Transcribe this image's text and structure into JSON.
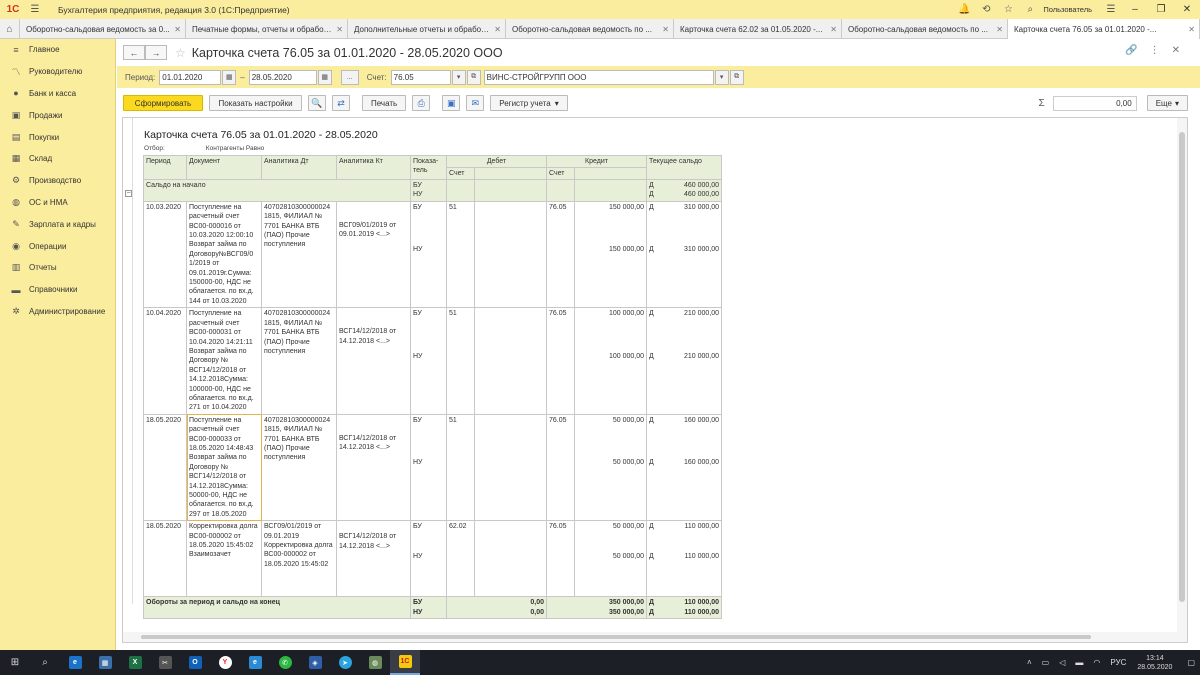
{
  "app": {
    "title": "Бухгалтерия предприятия, редакция 3.0  (1С:Предприятие)",
    "user": "Пользователь"
  },
  "tabs": [
    "Оборотно-сальдовая ведомость за 0...",
    "Печатные формы, отчеты и обработки",
    "Дополнительные отчеты и обработки",
    "Оборотно-сальдовая ведомость по ...",
    "Карточка счета 62.02 за 01.05.2020 -...",
    "Оборотно-сальдовая ведомость по ...",
    "Карточка счета 76.05 за 01.01.2020 -..."
  ],
  "sidebar": [
    {
      "label": "Главное",
      "icon": "menu-icon"
    },
    {
      "label": "Руководителю",
      "icon": "chart-line-icon"
    },
    {
      "label": "Банк и касса",
      "icon": "bank-icon"
    },
    {
      "label": "Продажи",
      "icon": "sales-icon"
    },
    {
      "label": "Покупки",
      "icon": "cart-icon"
    },
    {
      "label": "Склад",
      "icon": "warehouse-icon"
    },
    {
      "label": "Производство",
      "icon": "factory-icon"
    },
    {
      "label": "ОС и НМА",
      "icon": "assets-icon"
    },
    {
      "label": "Зарплата и кадры",
      "icon": "people-icon"
    },
    {
      "label": "Операции",
      "icon": "operations-icon"
    },
    {
      "label": "Отчеты",
      "icon": "reports-icon"
    },
    {
      "label": "Справочники",
      "icon": "book-icon"
    },
    {
      "label": "Администрирование",
      "icon": "gear-icon"
    }
  ],
  "document": {
    "title": "Карточка счета 76.05 за 01.01.2020 - 28.05.2020 ООО"
  },
  "filters": {
    "period_label": "Период:",
    "date_from": "01.01.2020",
    "dash": "–",
    "date_to": "28.05.2020",
    "dots": "...",
    "account_label": "Счет:",
    "account": "76.05",
    "counterparty": "ВИНС-СТРОЙГРУПП ООО"
  },
  "toolbar": {
    "generate": "Сформировать",
    "show_settings": "Показать настройки",
    "print": "Печать",
    "registry": "Регистр учета",
    "sum_symbol": "Σ",
    "sum_value": "0,00",
    "more": "Еще"
  },
  "report": {
    "title": "Карточка счета 76.05 за 01.01.2020 - 28.05.2020",
    "filter_label": "Отбор:",
    "filter_value": "Контрагенты Равно",
    "headers": {
      "period": "Период",
      "document": "Документ",
      "analytics_dt": "Аналитика Дт",
      "analytics_kt": "Аналитика Кт",
      "indicator": "Показа-\nтель",
      "debit": "Дебет",
      "credit": "Кредит",
      "balance": "Текущее сальдо",
      "account": "Счет"
    },
    "opening": {
      "label": "Сальдо на начало",
      "bu": "БУ",
      "nu": "НУ",
      "d1": "Д",
      "v1": "460 000,00",
      "d2": "Д",
      "v2": "460 000,00"
    },
    "rows": [
      {
        "period": "10.03.2020",
        "document": "Поступление на расчетный счет ВС00-000016 от 10.03.2020 12:00:10 Возврат займа по Договору№ВСГ09/0 1/2019 от 09.01.2019г.Сумма: 150000-00, НДС не облагается. по вх.д. 144 от 10.03.2020",
        "analytics_dt": "40702810300000024 1815, ФИЛИАЛ № 7701 БАНКА ВТБ (ПАО) Прочие поступления",
        "analytics_kt": "ВСГ09/01/2019 от 09.01.2019 <...>",
        "bu": "БУ",
        "nu": "НУ",
        "debit_acc": "51",
        "credit_acc": "76.05",
        "credit_bu": "150 000,00",
        "credit_nu": "150 000,00",
        "bal_d1": "Д",
        "bal_bu": "310 000,00",
        "bal_d2": "Д",
        "bal_nu": "310 000,00"
      },
      {
        "period": "10.04.2020",
        "document": "Поступление на расчетный счет ВС00-000031 от 10.04.2020 14:21:11 Возврат займа по Договору № ВСГ14/12/2018 от 14.12.2018Сумма: 100000-00, НДС не облагается. по вх.д. 271 от 10.04.2020",
        "analytics_dt": "40702810300000024 1815, ФИЛИАЛ № 7701 БАНКА ВТБ (ПАО) Прочие поступления",
        "analytics_kt": "ВСГ14/12/2018 от 14.12.2018 <...>",
        "bu": "БУ",
        "nu": "НУ",
        "debit_acc": "51",
        "credit_acc": "76.05",
        "credit_bu": "100 000,00",
        "credit_nu": "100 000,00",
        "bal_d1": "Д",
        "bal_bu": "210 000,00",
        "bal_d2": "Д",
        "bal_nu": "210 000,00"
      },
      {
        "period": "18.05.2020",
        "document": "Поступление на расчетный счет ВС00-000033 от 18.05.2020 14:48:43 Возврат займа по Договору № ВСГ14/12/2018 от 14.12.2018Сумма: 50000-00, НДС не облагается. по вх.д. 297 от 18.05.2020",
        "analytics_dt": "40702810300000024 1815, ФИЛИАЛ № 7701 БАНКА ВТБ (ПАО) Прочие поступления",
        "analytics_kt": "ВСГ14/12/2018 от 14.12.2018 <...>",
        "bu": "БУ",
        "nu": "НУ",
        "debit_acc": "51",
        "credit_acc": "76.05",
        "credit_bu": "50 000,00",
        "credit_nu": "50 000,00",
        "bal_d1": "Д",
        "bal_bu": "160 000,00",
        "bal_d2": "Д",
        "bal_nu": "160 000,00"
      },
      {
        "period": "18.05.2020",
        "document": "Корректировка долга ВС00-000002 от 18.05.2020 15:45:02 Взаимозачет",
        "analytics_dt": "ВСГ09/01/2019 от 09.01.2019 Корректировка долга ВС00-000002 от 18.05.2020 15:45:02",
        "analytics_kt": "ВСГ14/12/2018 от 14.12.2018 <...>",
        "bu": "БУ",
        "nu": "НУ",
        "debit_acc": "62.02",
        "credit_acc": "76.05",
        "credit_bu": "50 000,00",
        "credit_nu": "50 000,00",
        "bal_d1": "Д",
        "bal_bu": "110 000,00",
        "bal_d2": "Д",
        "bal_nu": "110 000,00"
      }
    ],
    "totals": {
      "label": "Обороты за период и сальдо на конец",
      "bu": "БУ",
      "nu": "НУ",
      "debit_bu": "0,00",
      "debit_nu": "0,00",
      "credit_bu": "350 000,00",
      "credit_nu": "350 000,00",
      "d1": "Д",
      "bal_bu": "110 000,00",
      "d2": "Д",
      "bal_nu": "110 000,00"
    }
  },
  "taskbar": {
    "lang": "РУС",
    "time": "13:14",
    "date": "28.05.2020"
  },
  "colors": {
    "accent_yellow": "#fbed9e",
    "button_yellow": "#fbd91e",
    "table_header_green": "#e8efd8"
  }
}
